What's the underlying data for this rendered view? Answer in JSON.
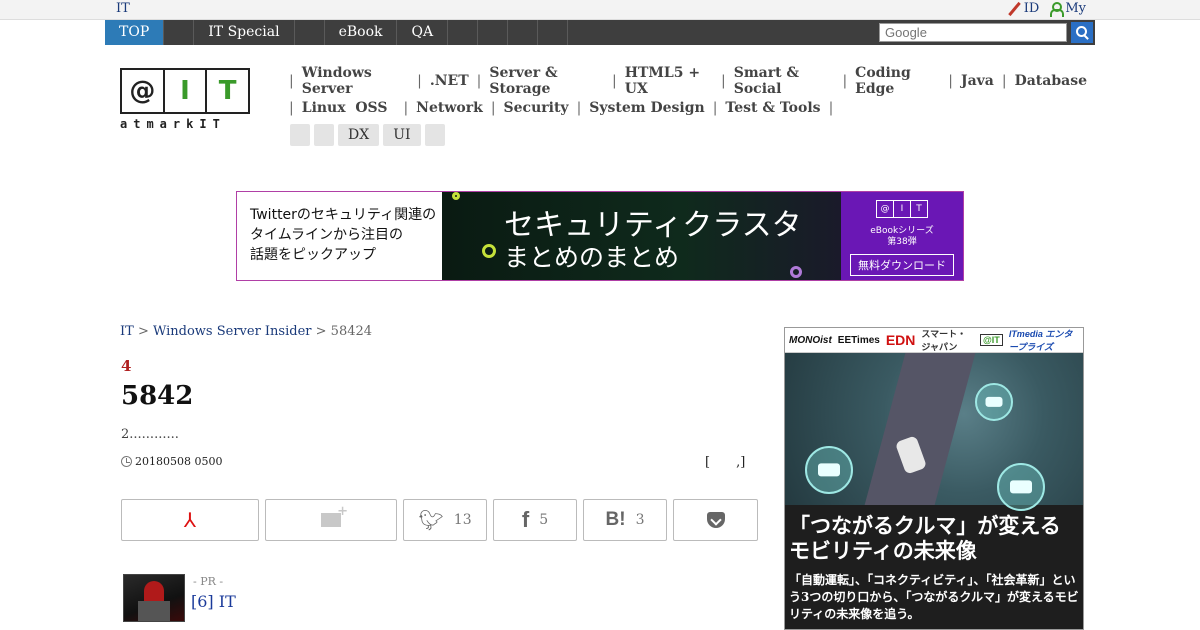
{
  "util": {
    "site": "IT",
    "id_label": "ID",
    "my_label": "My"
  },
  "nav": {
    "tabs": [
      "TOP",
      "",
      "IT Special",
      "",
      "eBook",
      "QA",
      "",
      "",
      "",
      ""
    ],
    "search_placeholder": "Google"
  },
  "logo": {
    "cells": [
      "@",
      "I",
      "T"
    ],
    "sub": "atmarkIT"
  },
  "categories": {
    "row1": [
      "Windows Server",
      ".NET",
      "Server & Storage",
      "HTML5 + UX",
      "Smart & Social",
      "Coding Edge",
      "Java",
      "Database"
    ],
    "row2": [
      "Linux  OSS",
      "Network",
      "Security",
      "System Design",
      "Test & Tools"
    ],
    "tags": [
      "",
      "",
      "DX",
      "UI",
      ""
    ]
  },
  "banner": {
    "left_lines": [
      "Twitterのセキュリティ関連の",
      "タイムラインから注目の",
      "話題をピックアップ"
    ],
    "title1": "セキュリティクラスタ",
    "title2": "まとめのまとめ",
    "mini_logo": [
      "@",
      "I",
      "T"
    ],
    "ebook": "eBookシリーズ",
    "ebook_no": "第38弾",
    "download": "無料ダウンロード"
  },
  "breadcrumb": {
    "root": "IT",
    "section": "Windows Server Insider",
    "current": "58424"
  },
  "article": {
    "kicker": "4",
    "title": "5842",
    "lead": "2............",
    "date": "20180508 0500",
    "author": "[　　,]"
  },
  "share": {
    "twitter_count": "13",
    "facebook_count": "5",
    "hatena_count": "3"
  },
  "pr": {
    "label": "- PR -",
    "link": "[6] IT"
  },
  "ad": {
    "logos": [
      "MONOist",
      "EETimes",
      "EDN",
      "スマート・ジャパン",
      "@IT",
      "ITmedia エンタープライズ"
    ],
    "headline": "「つながるクルマ」が変える モビリティの未来像",
    "body": "「自動運転」、「コネクティビティ」、「社会革新」という3つの切り口から、「つながるクルマ」が変えるモビリティの未来像を追う。"
  },
  "colors": {
    "nav_active": "#2d7bb7",
    "nav_bg": "#3e3e3e",
    "banner_right": "#6a17b5",
    "kicker": "#b02020"
  }
}
